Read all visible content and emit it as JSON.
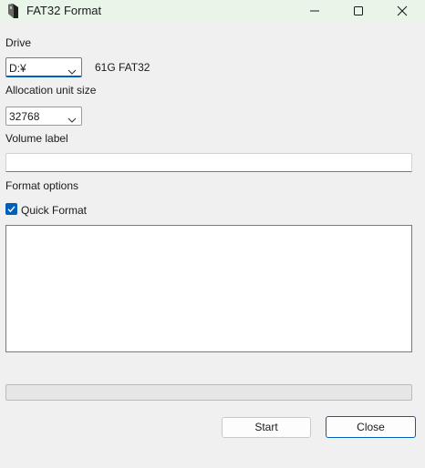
{
  "window": {
    "title": "FAT32 Format",
    "icon": "usb-drive-icon",
    "controls": {
      "minimize": "minimize-icon",
      "maximize": "maximize-icon",
      "close": "close-icon"
    }
  },
  "drive": {
    "label": "Drive",
    "selected": "D:¥",
    "info": "61G FAT32"
  },
  "allocation": {
    "label": "Allocation unit size",
    "selected": "32768"
  },
  "volume": {
    "label": "Volume label",
    "value": ""
  },
  "options": {
    "label": "Format options",
    "quick_format_label": "Quick Format",
    "quick_format_checked": true
  },
  "log": {
    "text": ""
  },
  "progress": {
    "value": 0
  },
  "buttons": {
    "start": "Start",
    "close": "Close"
  },
  "colors": {
    "titlebar": "#eaf5ea",
    "accent": "#005fb8",
    "background": "#f0f0f0"
  }
}
